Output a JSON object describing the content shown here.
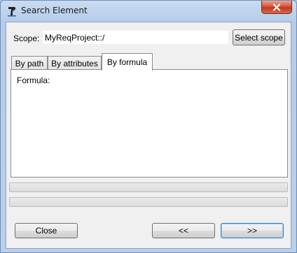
{
  "window": {
    "title": "Search Element",
    "app_icon": "app-logo-icon",
    "close_icon": "close-icon"
  },
  "scope": {
    "label": "Scope:",
    "value": "MyReqProject::/",
    "select_button": "Select scope"
  },
  "tabs": [
    {
      "label": "By path",
      "active": false
    },
    {
      "label": "By attributes",
      "active": false
    },
    {
      "label": "By formula",
      "active": true
    }
  ],
  "formula_panel": {
    "label": "Formula:"
  },
  "footer": {
    "close_label": "Close",
    "prev_label": "<<",
    "next_label": ">>"
  },
  "colors": {
    "titlebar": "#b9cfea",
    "close_button": "#c3391f",
    "focus_border": "#3c7fb1"
  }
}
